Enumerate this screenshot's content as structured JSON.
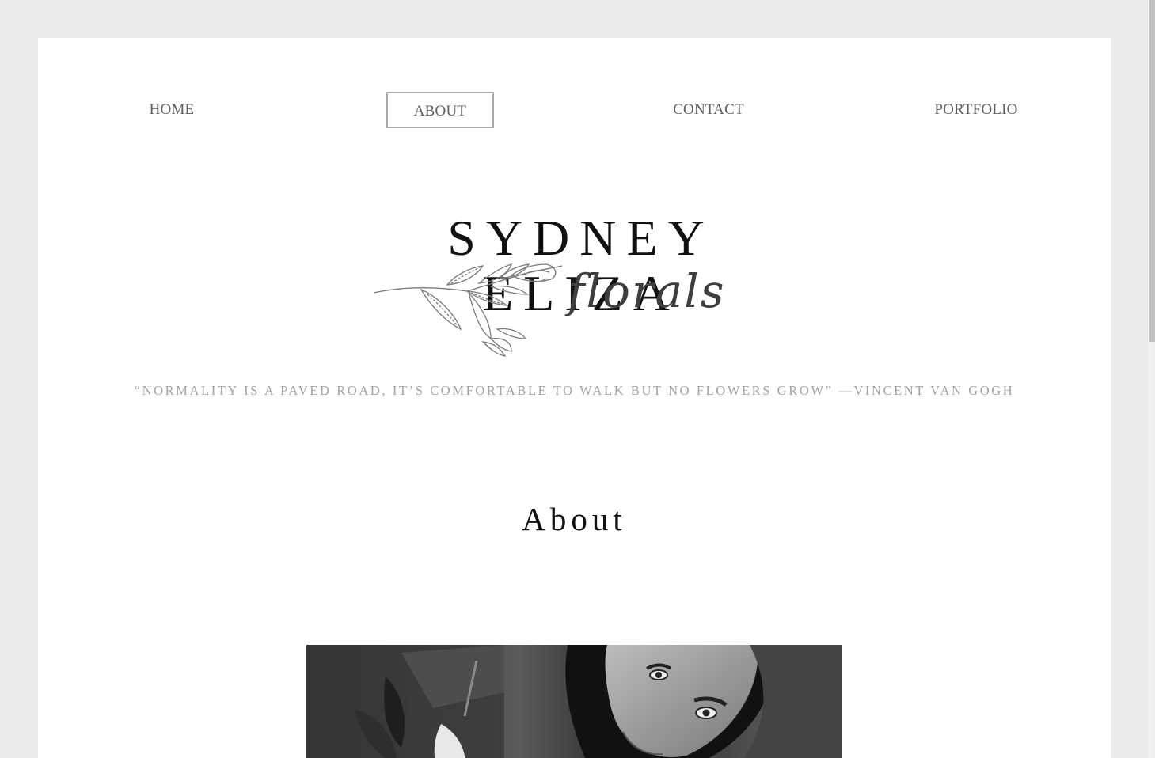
{
  "nav": {
    "items": [
      {
        "label": "HOME"
      },
      {
        "label": "ABOUT"
      },
      {
        "label": "CONTACT"
      },
      {
        "label": "PORTFOLIO"
      }
    ],
    "active": "ABOUT"
  },
  "logo": {
    "name": "SYDNEY ELIZA",
    "script": "florals"
  },
  "tagline": "“NORMALITY IS A PAVED ROAD, IT’S COMFORTABLE TO WALK BUT NO FLOWERS GROW” —VINCENT VAN GOGH",
  "page_title": "About",
  "colors": {
    "background": "#ececec",
    "card": "#ffffff",
    "nav_text": "#5e5e5e",
    "active_border": "#a8a8a8",
    "tagline": "#a2a2a2",
    "title": "#111111"
  }
}
